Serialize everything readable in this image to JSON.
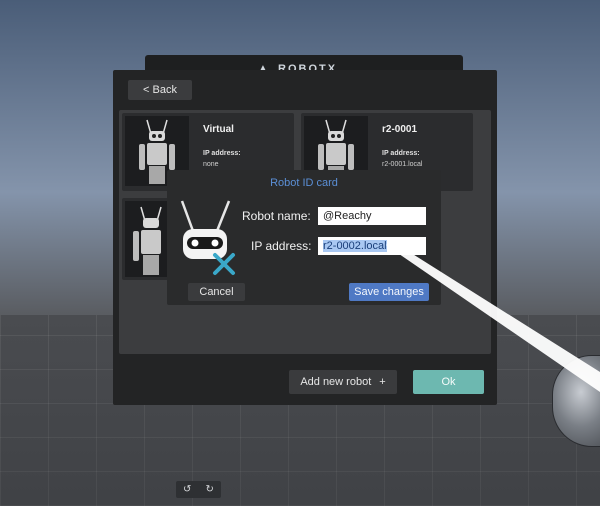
{
  "header": {
    "banner_text": "ROBOTX"
  },
  "toolbar": {
    "back_label": "< Back"
  },
  "robots": [
    {
      "name": "Virtual",
      "ip_label": "IP address:",
      "ip_value": "none"
    },
    {
      "name": "r2-0001",
      "ip_label": "IP address:",
      "ip_value": "r2-0001.local"
    }
  ],
  "dialog": {
    "title": "Robot ID card",
    "name_label": "Robot name:",
    "name_value": "@Reachy",
    "ip_label": "IP address:",
    "ip_value": "r2-0002.local",
    "cancel_label": "Cancel",
    "save_label": "Save changes"
  },
  "footer": {
    "add_robot_label": "Add new robot",
    "add_icon": "+",
    "ok_label": "Ok"
  },
  "undo_bar": {
    "undo_icon": "↺",
    "redo_icon": "↻"
  },
  "colors": {
    "accent_blue": "#4f79c4",
    "ok_teal": "#6db8b0",
    "title_blue": "#5b8fd6"
  }
}
